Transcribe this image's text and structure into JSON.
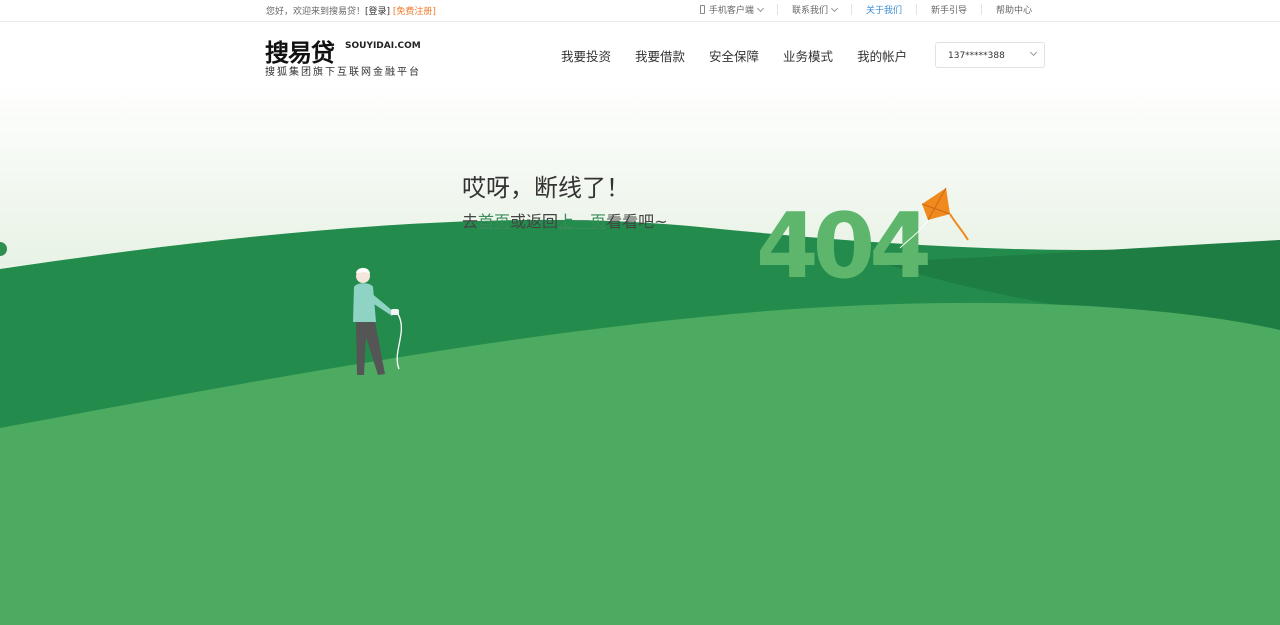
{
  "topbar": {
    "greeting": "您好，欢迎来到搜易贷！",
    "login": "[登录]",
    "register": "[免费注册]",
    "links": [
      {
        "label": "手机客户端",
        "icon": "phone-icon",
        "dropdown": true
      },
      {
        "label": "联系我们",
        "dropdown": true
      },
      {
        "label": "关于我们",
        "active": true
      },
      {
        "label": "新手引导"
      },
      {
        "label": "帮助中心"
      }
    ]
  },
  "header": {
    "logo": {
      "brand": "搜易贷",
      "domain": "SOUYIDAI.COM",
      "tagline": "搜狐集团旗下互联网金融平台"
    },
    "nav": [
      "我要投资",
      "我要借款",
      "安全保障",
      "业务模式",
      "我的帐户"
    ],
    "account": "137*****388"
  },
  "error": {
    "title": "哎呀，断线了！",
    "sub_prefix": "去",
    "home_link": "首页",
    "sub_middle": "或返回",
    "back_link": "上一页",
    "sub_suffix": "看看吧~",
    "code": "404"
  },
  "colors": {
    "hill_dark": "#238c4c",
    "hill_light": "#4cab60",
    "sky_tint": "#e9f3e7",
    "digit": "#5db66c",
    "kite": "#f08a1f",
    "accent_link": "#3a8a5a"
  }
}
